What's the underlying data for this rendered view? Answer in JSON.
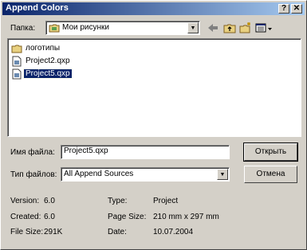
{
  "window": {
    "title": "Append Colors",
    "help_label": "?",
    "close_label": "✕"
  },
  "location": {
    "label": "Папка:",
    "value": "Мои рисунки"
  },
  "files": [
    {
      "name": "логотипы",
      "icon": "folder-icon"
    },
    {
      "name": "Project2.qxp",
      "icon": "document-icon"
    },
    {
      "name": "Project5.qxp",
      "icon": "document-icon",
      "selected": true
    }
  ],
  "filename": {
    "label": "Имя файла:",
    "value": "Project5.qxp"
  },
  "filetype": {
    "label": "Тип файлов:",
    "value": "All Append Sources"
  },
  "buttons": {
    "open": "Открыть",
    "cancel": "Отмена"
  },
  "info": {
    "version_label": "Version:",
    "version_value": "6.0",
    "created_label": "Created:",
    "created_value": "6.0",
    "size_label": "File Size:",
    "size_value": "291K",
    "type_label": "Type:",
    "type_value": "Project",
    "pagesize_label": "Page Size:",
    "pagesize_value": "210 mm x 297 mm",
    "date_label": "Date:",
    "date_value": "10.07.2004"
  },
  "colors": {
    "titlebar_start": "#0a246a",
    "titlebar_end": "#a6caf0",
    "selection": "#0a246a",
    "face": "#d4d0c8"
  }
}
